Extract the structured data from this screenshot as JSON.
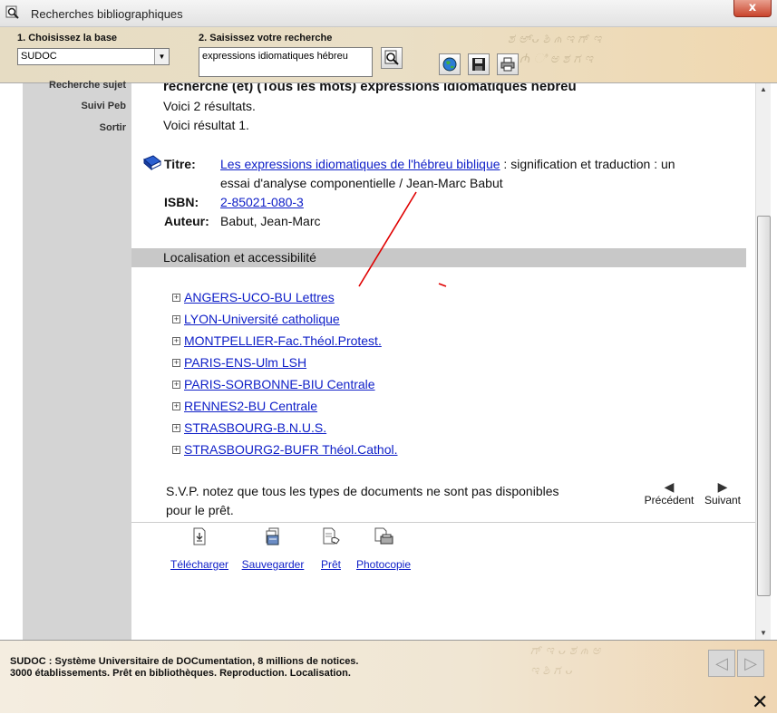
{
  "window": {
    "title": "Recherches bibliographiques",
    "close_glyph": "x"
  },
  "header": {
    "base_label": "1. Choisissez la base",
    "base_value": "SUDOC",
    "search_label": "2. Saisissez votre recherche",
    "search_value": "expressions idiomatiques hébreu"
  },
  "sidebar": {
    "items": [
      {
        "label": "Recherche sujet"
      },
      {
        "label": "Suivi Peb"
      },
      {
        "label": "Sortir"
      }
    ]
  },
  "results": {
    "query_line": "recherche (et) (Tous les mots) expressions idiomatiques hébreu",
    "count_line": "Voici 2 résultats.",
    "current_line": "Voici résultat 1.",
    "titre_label": "Titre:",
    "titre_link": "Les expressions idiomatiques de l'hébreu biblique",
    "titre_rest_1": " : signification et traduction : un",
    "titre_rest_2": "essai d'analyse componentielle / Jean-Marc Babut",
    "isbn_label": "ISBN:",
    "isbn_value": "2-85021-080-3",
    "auteur_label": "Auteur:",
    "auteur_value": "Babut, Jean-Marc"
  },
  "localisation": {
    "header": "Localisation et accessibilité",
    "libraries": [
      "ANGERS-UCO-BU Lettres",
      "LYON-Université catholique",
      "MONTPELLIER-Fac.Théol.Protest.",
      "PARIS-ENS-Ulm LSH",
      "PARIS-SORBONNE-BIU Centrale",
      "RENNES2-BU Centrale",
      "STRASBOURG-B.N.U.S.",
      "STRASBOURG2-BUFR Théol.Cathol."
    ]
  },
  "notice": {
    "line1": "S.V.P. notez que tous les types de documents ne sont pas disponibles",
    "line2": "pour le prêt."
  },
  "nav": {
    "prev": "Précédent",
    "next": "Suivant"
  },
  "actions": {
    "download": "Télécharger",
    "save": "Sauvegarder",
    "loan": "Prêt",
    "photocopy": "Photocopie"
  },
  "footer": {
    "line1": "SUDOC : Système Universitaire de DOCumentation, 8 millions de notices.",
    "line2": "3000 établissements. Prêt en bibliothèques. Reproduction. Localisation."
  },
  "colors": {
    "link": "#1020c8",
    "annotation": "#e00000",
    "sidebar": "#d4d4d4",
    "loc_header": "#c8c8c8"
  }
}
